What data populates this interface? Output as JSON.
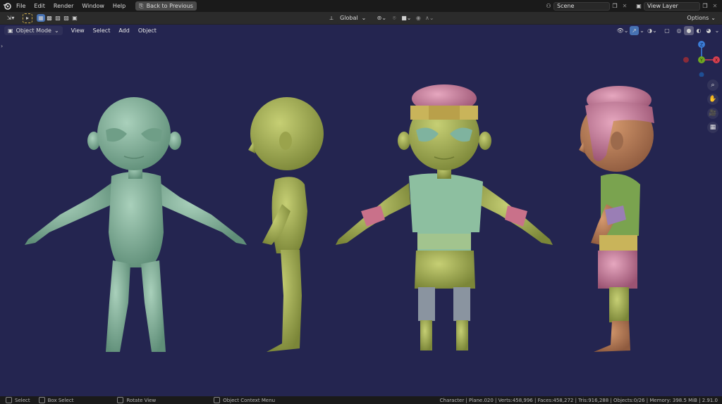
{
  "topbar": {
    "menus": [
      "File",
      "Edit",
      "Render",
      "Window",
      "Help"
    ],
    "back_label": "Back to Previous",
    "scene_name": "Scene",
    "view_layer_name": "View Layer"
  },
  "toolbar": {
    "orientation": "Global",
    "options_label": "Options"
  },
  "viewport_header": {
    "mode": "Object Mode",
    "menus": [
      "View",
      "Select",
      "Add",
      "Object"
    ]
  },
  "gizmo": {
    "z": "Z",
    "y": "Y",
    "x": "X"
  },
  "statusbar": {
    "select": "Select",
    "box_select": "Box Select",
    "rotate_view": "Rotate View",
    "context_menu": "Object Context Menu",
    "stats": "Character | Plane.020 | Verts:458,996 | Faces:458,272 | Tris:916,288 | Objects:0/26 | Memory: 398.5 MiB | 2.91.0"
  },
  "colors": {
    "viewport_bg": "#242550",
    "teal_body": "#87b39c",
    "olive_body": "#aab45a",
    "pink_hair": "#d38aa6",
    "headband": "#c9b45a",
    "shirt": "#8dbfa0",
    "skirt": "#b3ac5c",
    "pants": "#8a94a0"
  }
}
